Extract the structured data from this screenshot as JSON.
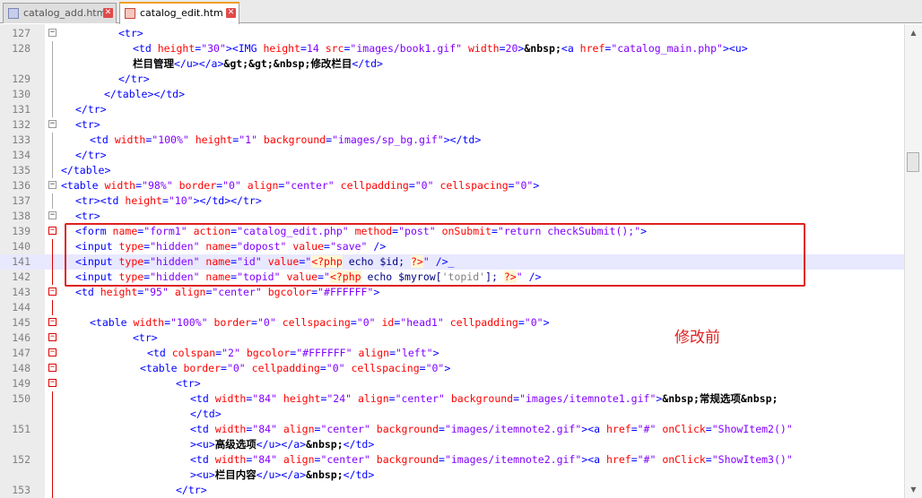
{
  "tabs": [
    {
      "label": "catalog_add.htm",
      "close_icon": "close-icon"
    },
    {
      "label": "catalog_edit.htm",
      "close_icon": "close-icon"
    }
  ],
  "annotation": "修改前",
  "current_line": "141",
  "lines": [
    {
      "n": "127",
      "fold": "minus",
      "indent": 64,
      "tokens": [
        [
          "tag",
          "<tr>"
        ]
      ]
    },
    {
      "n": "128",
      "fold": "",
      "indent": 80,
      "tokens": [
        [
          "tag",
          "<td "
        ],
        [
          "attr",
          "height"
        ],
        [
          "tag",
          "="
        ],
        [
          "val",
          "\"30\""
        ],
        [
          "tag",
          "><IMG "
        ],
        [
          "attr",
          "height"
        ],
        [
          "tag",
          "="
        ],
        [
          "val",
          "14 "
        ],
        [
          "attr",
          "src"
        ],
        [
          "tag",
          "="
        ],
        [
          "val",
          "\"images/book1.gif\" "
        ],
        [
          "attr",
          "width"
        ],
        [
          "tag",
          "="
        ],
        [
          "val",
          "20"
        ],
        [
          "tag",
          ">"
        ],
        [
          "ent",
          "&nbsp;"
        ],
        [
          "tag",
          "<a "
        ],
        [
          "attr",
          "href"
        ],
        [
          "tag",
          "="
        ],
        [
          "val",
          "\"catalog_main.php\""
        ],
        [
          "tag",
          "><u>"
        ]
      ]
    },
    {
      "n": "",
      "fold": "",
      "indent": 80,
      "tokens": [
        [
          "cn",
          "栏目管理"
        ],
        [
          "tag",
          "</u></a>"
        ],
        [
          "ent",
          "&gt;&gt;&nbsp;"
        ],
        [
          "cn",
          "修改栏目"
        ],
        [
          "tag",
          "</td>"
        ]
      ]
    },
    {
      "n": "129",
      "fold": "",
      "indent": 64,
      "tokens": [
        [
          "tag",
          "</tr>"
        ]
      ]
    },
    {
      "n": "130",
      "fold": "",
      "indent": 48,
      "tokens": [
        [
          "tag",
          "</table></td>"
        ]
      ]
    },
    {
      "n": "131",
      "fold": "",
      "indent": 16,
      "tokens": [
        [
          "tag",
          "</tr>"
        ]
      ]
    },
    {
      "n": "132",
      "fold": "minus",
      "indent": 16,
      "tokens": [
        [
          "tag",
          "<tr>"
        ]
      ]
    },
    {
      "n": "133",
      "fold": "",
      "indent": 32,
      "tokens": [
        [
          "tag",
          "<td "
        ],
        [
          "attr",
          "width"
        ],
        [
          "tag",
          "="
        ],
        [
          "val",
          "\"100%\" "
        ],
        [
          "attr",
          "height"
        ],
        [
          "tag",
          "="
        ],
        [
          "val",
          "\"1\" "
        ],
        [
          "attr",
          "background"
        ],
        [
          "tag",
          "="
        ],
        [
          "val",
          "\"images/sp_bg.gif\""
        ],
        [
          "tag",
          "></td>"
        ]
      ]
    },
    {
      "n": "134",
      "fold": "",
      "indent": 16,
      "tokens": [
        [
          "tag",
          "</tr>"
        ]
      ]
    },
    {
      "n": "135",
      "fold": "",
      "indent": 0,
      "tokens": [
        [
          "tag",
          "</table>"
        ]
      ]
    },
    {
      "n": "136",
      "fold": "minus",
      "indent": 0,
      "tokens": [
        [
          "tag",
          "<table "
        ],
        [
          "attr",
          "width"
        ],
        [
          "tag",
          "="
        ],
        [
          "val",
          "\"98%\" "
        ],
        [
          "attr",
          "border"
        ],
        [
          "tag",
          "="
        ],
        [
          "val",
          "\"0\" "
        ],
        [
          "attr",
          "align"
        ],
        [
          "tag",
          "="
        ],
        [
          "val",
          "\"center\" "
        ],
        [
          "attr",
          "cellpadding"
        ],
        [
          "tag",
          "="
        ],
        [
          "val",
          "\"0\" "
        ],
        [
          "attr",
          "cellspacing"
        ],
        [
          "tag",
          "="
        ],
        [
          "val",
          "\"0\""
        ],
        [
          "tag",
          ">"
        ]
      ]
    },
    {
      "n": "137",
      "fold": "",
      "indent": 16,
      "tokens": [
        [
          "tag",
          "<tr><td "
        ],
        [
          "attr",
          "height"
        ],
        [
          "tag",
          "="
        ],
        [
          "val",
          "\"10\""
        ],
        [
          "tag",
          "></td></tr>"
        ]
      ]
    },
    {
      "n": "138",
      "fold": "minus",
      "indent": 16,
      "tokens": [
        [
          "tag",
          "<tr>"
        ]
      ]
    },
    {
      "n": "139",
      "fold": "minus-red",
      "indent": 16,
      "tokens": [
        [
          "tag",
          "<form "
        ],
        [
          "attr",
          "name"
        ],
        [
          "tag",
          "="
        ],
        [
          "val",
          "\"form1\" "
        ],
        [
          "attr",
          "action"
        ],
        [
          "tag",
          "="
        ],
        [
          "val",
          "\"catalog_edit.php\" "
        ],
        [
          "attr",
          "method"
        ],
        [
          "tag",
          "="
        ],
        [
          "val",
          "\"post\" "
        ],
        [
          "attr",
          "onSubmit"
        ],
        [
          "tag",
          "="
        ],
        [
          "val",
          "\"return checkSubmit();\""
        ],
        [
          "tag",
          ">"
        ]
      ]
    },
    {
      "n": "140",
      "fold": "",
      "indent": 16,
      "tokens": [
        [
          "tag",
          "<input "
        ],
        [
          "attr",
          "type"
        ],
        [
          "tag",
          "="
        ],
        [
          "val",
          "\"hidden\" "
        ],
        [
          "attr",
          "name"
        ],
        [
          "tag",
          "="
        ],
        [
          "val",
          "\"dopost\" "
        ],
        [
          "attr",
          "value"
        ],
        [
          "tag",
          "="
        ],
        [
          "val",
          "\"save\" "
        ],
        [
          "tag",
          "/>"
        ]
      ]
    },
    {
      "n": "141",
      "fold": "",
      "indent": 16,
      "tokens": [
        [
          "tag",
          "<input "
        ],
        [
          "attr",
          "type"
        ],
        [
          "tag",
          "="
        ],
        [
          "val",
          "\"hidden\" "
        ],
        [
          "attr",
          "name"
        ],
        [
          "tag",
          "="
        ],
        [
          "val",
          "\"id\" "
        ],
        [
          "attr",
          "value"
        ],
        [
          "tag",
          "="
        ],
        [
          "val",
          "\""
        ],
        [
          "php",
          "<?php"
        ],
        [
          "kw",
          " echo $id; "
        ],
        [
          "php",
          "?>"
        ],
        [
          "val",
          "\" "
        ],
        [
          "tag",
          "/>_"
        ]
      ]
    },
    {
      "n": "142",
      "fold": "",
      "indent": 16,
      "tokens": [
        [
          "tag",
          "<input "
        ],
        [
          "attr",
          "type"
        ],
        [
          "tag",
          "="
        ],
        [
          "val",
          "\"hidden\" "
        ],
        [
          "attr",
          "name"
        ],
        [
          "tag",
          "="
        ],
        [
          "val",
          "\"topid\" "
        ],
        [
          "attr",
          "value"
        ],
        [
          "tag",
          "="
        ],
        [
          "val",
          "\""
        ],
        [
          "php",
          "<?php"
        ],
        [
          "kw",
          " echo $myrow["
        ],
        [
          "pstr",
          "'topid'"
        ],
        [
          "kw",
          "]; "
        ],
        [
          "php",
          "?>"
        ],
        [
          "val",
          "\" "
        ],
        [
          "tag",
          "/>"
        ]
      ]
    },
    {
      "n": "143",
      "fold": "minus-red",
      "indent": 16,
      "tokens": [
        [
          "tag",
          "<td "
        ],
        [
          "attr",
          "height"
        ],
        [
          "tag",
          "="
        ],
        [
          "val",
          "\"95\" "
        ],
        [
          "attr",
          "align"
        ],
        [
          "tag",
          "="
        ],
        [
          "val",
          "\"center\" "
        ],
        [
          "attr",
          "bgcolor"
        ],
        [
          "tag",
          "="
        ],
        [
          "val",
          "\"#FFFFFF\""
        ],
        [
          "tag",
          ">"
        ]
      ]
    },
    {
      "n": "144",
      "fold": "",
      "indent": 0,
      "tokens": []
    },
    {
      "n": "145",
      "fold": "minus-red",
      "indent": 32,
      "tokens": [
        [
          "tag",
          "<table "
        ],
        [
          "attr",
          "width"
        ],
        [
          "tag",
          "="
        ],
        [
          "val",
          "\"100%\" "
        ],
        [
          "attr",
          "border"
        ],
        [
          "tag",
          "="
        ],
        [
          "val",
          "\"0\" "
        ],
        [
          "attr",
          "cellspacing"
        ],
        [
          "tag",
          "="
        ],
        [
          "val",
          "\"0\" "
        ],
        [
          "attr",
          "id"
        ],
        [
          "tag",
          "="
        ],
        [
          "val",
          "\"head1\" "
        ],
        [
          "attr",
          "cellpadding"
        ],
        [
          "tag",
          "="
        ],
        [
          "val",
          "\"0\""
        ],
        [
          "tag",
          ">"
        ]
      ]
    },
    {
      "n": "146",
      "fold": "minus-red",
      "indent": 80,
      "tokens": [
        [
          "tag",
          "<tr>"
        ]
      ]
    },
    {
      "n": "147",
      "fold": "minus-red",
      "indent": 96,
      "tokens": [
        [
          "tag",
          "<td "
        ],
        [
          "attr",
          "colspan"
        ],
        [
          "tag",
          "="
        ],
        [
          "val",
          "\"2\" "
        ],
        [
          "attr",
          "bgcolor"
        ],
        [
          "tag",
          "="
        ],
        [
          "val",
          "\"#FFFFFF\" "
        ],
        [
          "attr",
          "align"
        ],
        [
          "tag",
          "="
        ],
        [
          "val",
          "\"left\""
        ],
        [
          "tag",
          ">"
        ]
      ]
    },
    {
      "n": "148",
      "fold": "minus-red",
      "indent": 88,
      "tokens": [
        [
          "tag",
          "<table "
        ],
        [
          "attr",
          "border"
        ],
        [
          "tag",
          "="
        ],
        [
          "val",
          "\"0\" "
        ],
        [
          "attr",
          "cellpadding"
        ],
        [
          "tag",
          "="
        ],
        [
          "val",
          "\"0\" "
        ],
        [
          "attr",
          "cellspacing"
        ],
        [
          "tag",
          "="
        ],
        [
          "val",
          "\"0\""
        ],
        [
          "tag",
          ">"
        ]
      ]
    },
    {
      "n": "149",
      "fold": "minus-red",
      "indent": 128,
      "tokens": [
        [
          "tag",
          "<tr>"
        ]
      ]
    },
    {
      "n": "150",
      "fold": "",
      "indent": 144,
      "tokens": [
        [
          "tag",
          "<td "
        ],
        [
          "attr",
          "width"
        ],
        [
          "tag",
          "="
        ],
        [
          "val",
          "\"84\" "
        ],
        [
          "attr",
          "height"
        ],
        [
          "tag",
          "="
        ],
        [
          "val",
          "\"24\" "
        ],
        [
          "attr",
          "align"
        ],
        [
          "tag",
          "="
        ],
        [
          "val",
          "\"center\" "
        ],
        [
          "attr",
          "background"
        ],
        [
          "tag",
          "="
        ],
        [
          "val",
          "\"images/itemnote1.gif\""
        ],
        [
          "tag",
          ">"
        ],
        [
          "ent",
          "&nbsp;"
        ],
        [
          "cn",
          "常规选项"
        ],
        [
          "ent",
          "&nbsp;"
        ]
      ]
    },
    {
      "n": "",
      "fold": "",
      "indent": 144,
      "tokens": [
        [
          "tag",
          "</td>"
        ]
      ]
    },
    {
      "n": "151",
      "fold": "",
      "indent": 144,
      "tokens": [
        [
          "tag",
          "<td "
        ],
        [
          "attr",
          "width"
        ],
        [
          "tag",
          "="
        ],
        [
          "val",
          "\"84\" "
        ],
        [
          "attr",
          "align"
        ],
        [
          "tag",
          "="
        ],
        [
          "val",
          "\"center\" "
        ],
        [
          "attr",
          "background"
        ],
        [
          "tag",
          "="
        ],
        [
          "val",
          "\"images/itemnote2.gif\""
        ],
        [
          "tag",
          "><a "
        ],
        [
          "attr",
          "href"
        ],
        [
          "tag",
          "="
        ],
        [
          "val",
          "\"#\" "
        ],
        [
          "attr",
          "onClick"
        ],
        [
          "tag",
          "="
        ],
        [
          "val",
          "\"ShowItem2()\""
        ]
      ]
    },
    {
      "n": "",
      "fold": "",
      "indent": 144,
      "tokens": [
        [
          "tag",
          "><u>"
        ],
        [
          "cn",
          "高级选项"
        ],
        [
          "tag",
          "</u></a>"
        ],
        [
          "ent",
          "&nbsp;"
        ],
        [
          "tag",
          "</td>"
        ]
      ]
    },
    {
      "n": "152",
      "fold": "",
      "indent": 144,
      "tokens": [
        [
          "tag",
          "<td "
        ],
        [
          "attr",
          "width"
        ],
        [
          "tag",
          "="
        ],
        [
          "val",
          "\"84\" "
        ],
        [
          "attr",
          "align"
        ],
        [
          "tag",
          "="
        ],
        [
          "val",
          "\"center\" "
        ],
        [
          "attr",
          "background"
        ],
        [
          "tag",
          "="
        ],
        [
          "val",
          "\"images/itemnote2.gif\""
        ],
        [
          "tag",
          "><a "
        ],
        [
          "attr",
          "href"
        ],
        [
          "tag",
          "="
        ],
        [
          "val",
          "\"#\" "
        ],
        [
          "attr",
          "onClick"
        ],
        [
          "tag",
          "="
        ],
        [
          "val",
          "\"ShowItem3()\""
        ]
      ]
    },
    {
      "n": "",
      "fold": "",
      "indent": 144,
      "tokens": [
        [
          "tag",
          "><u>"
        ],
        [
          "cn",
          "栏目内容"
        ],
        [
          "tag",
          "</u></a>"
        ],
        [
          "ent",
          "&nbsp;"
        ],
        [
          "tag",
          "</td>"
        ]
      ]
    },
    {
      "n": "153",
      "fold": "",
      "indent": 128,
      "tokens": [
        [
          "tag",
          "</tr>"
        ]
      ]
    }
  ]
}
